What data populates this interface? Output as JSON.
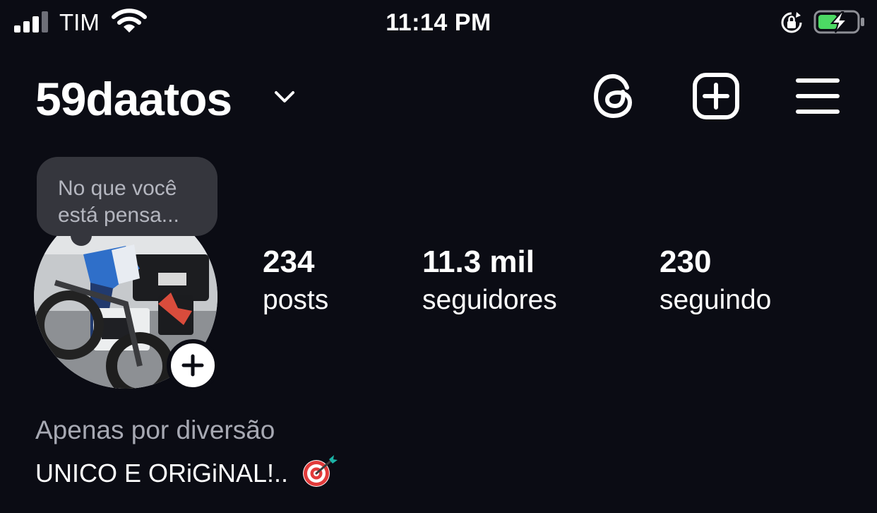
{
  "status_bar": {
    "carrier": "TIM",
    "time": "11:14 PM",
    "battery_color": "#4cd964"
  },
  "header": {
    "username": "59daatos",
    "icons": [
      "chevron-down-icon",
      "threads-icon",
      "create-icon",
      "menu-icon"
    ]
  },
  "profile": {
    "note_line1": "No que você",
    "note_line2": "está pensa...",
    "stats": {
      "posts_count": "234",
      "posts_label": "posts",
      "followers_count": "11.3 mil",
      "followers_label": "seguidores",
      "following_count": "230",
      "following_label": "seguindo"
    }
  },
  "bio": {
    "category": "Apenas por diversão",
    "text": "UNICO E ORiGiNAL!..",
    "emoji_icon": "direct-hit-target-icon"
  },
  "colors": {
    "background": "#0b0c14",
    "note_bubble": "#35363d",
    "secondary_text": "#a7a9b3"
  }
}
